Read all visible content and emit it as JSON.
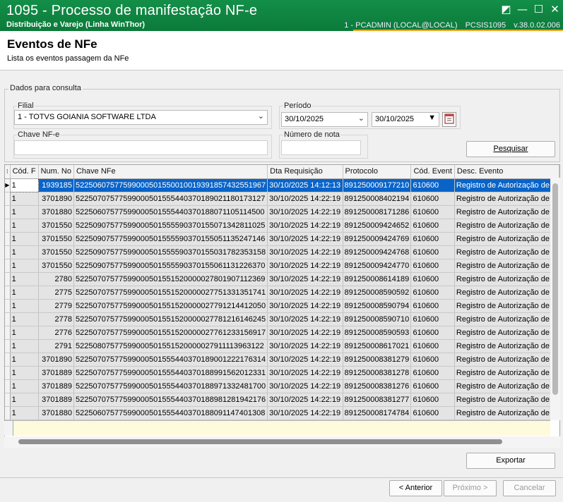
{
  "window": {
    "title": "1095 - Processo de manifestação NF-e",
    "subtitle": "Distribuição e Varejo (Linha WinThor)",
    "user": "1 - PCADMIN (LOCAL@LOCAL)",
    "program": "PCSIS1095",
    "version": "v.38.0.02.006",
    "buttons": [
      "◩",
      "—",
      "☐",
      "✕"
    ]
  },
  "header": {
    "title": "Eventos de NFe",
    "subtitle": "Lista os eventos passagem da NFe"
  },
  "query": {
    "group_title": "Dados para consulta",
    "filial_label": "Filial",
    "filial_value": "1 - TOTVS GOIANIA SOFTWARE LTDA",
    "periodo_label": "Período",
    "date_from": "30/10/2025",
    "date_to": "30/10/2025",
    "chave_label": "Chave NF-e",
    "chave_value": "",
    "numero_label": "Número de nota",
    "numero_value": "",
    "search_button": "Pesquisar"
  },
  "grid": {
    "columns": [
      "Cód. F",
      "Num. No",
      "Chave NFe",
      "Dta Requisição",
      "Protocolo",
      "Cód. Event",
      "Desc. Evento"
    ],
    "rows": [
      [
        "1",
        "1939185",
        "52250607577599000501550010019391857432551967",
        "30/10/2025 14:12:13",
        "891250009177210",
        "610600",
        "Registro de Autorização de C"
      ],
      [
        "1",
        "3701890",
        "52250707577599000501555440370189021180173127",
        "30/10/2025 14:22:19",
        "891250008402194",
        "610600",
        "Registro de Autorização de C"
      ],
      [
        "1",
        "3701880",
        "52250607577599000501555440370188071105114500",
        "30/10/2025 14:22:19",
        "891250008171286",
        "610600",
        "Registro de Autorização de C"
      ],
      [
        "1",
        "3701550",
        "52250907577599000501555590370155071342811025",
        "30/10/2025 14:22:19",
        "891250009424652",
        "610600",
        "Registro de Autorização de C"
      ],
      [
        "1",
        "3701550",
        "52250907577599000501555590370155051135247146",
        "30/10/2025 14:22:19",
        "891250009424769",
        "610600",
        "Registro de Autorização de C"
      ],
      [
        "1",
        "3701550",
        "52250907577599000501555590370155031782353158",
        "30/10/2025 14:22:19",
        "891250009424768",
        "610600",
        "Registro de Autorização de C"
      ],
      [
        "1",
        "3701550",
        "52250907577599000501555590370155061131226370",
        "30/10/2025 14:22:19",
        "891250009424770",
        "610600",
        "Registro de Autorização de C"
      ],
      [
        "1",
        "2780",
        "52250707577599000501551520000027801907112369",
        "30/10/2025 14:22:19",
        "891250008614189",
        "610600",
        "Registro de Autorização de C"
      ],
      [
        "1",
        "2775",
        "52250707577599000501551520000027751331351741",
        "30/10/2025 14:22:19",
        "891250008590592",
        "610600",
        "Registro de Autorização de C"
      ],
      [
        "1",
        "2779",
        "52250707577599000501551520000027791214412050",
        "30/10/2025 14:22:19",
        "891250008590794",
        "610600",
        "Registro de Autorização de C"
      ],
      [
        "1",
        "2778",
        "52250707577599000501551520000027781216146245",
        "30/10/2025 14:22:19",
        "891250008590710",
        "610600",
        "Registro de Autorização de C"
      ],
      [
        "1",
        "2776",
        "52250707577599000501551520000027761233156917",
        "30/10/2025 14:22:19",
        "891250008590593",
        "610600",
        "Registro de Autorização de C"
      ],
      [
        "1",
        "2791",
        "52250807577599000501551520000027911113963122",
        "30/10/2025 14:22:19",
        "891250008617021",
        "610600",
        "Registro de Autorização de C"
      ],
      [
        "1",
        "3701890",
        "52250707577599000501555440370189001222176314",
        "30/10/2025 14:22:19",
        "891250008381279",
        "610600",
        "Registro de Autorização de C"
      ],
      [
        "1",
        "3701889",
        "52250707577599000501555440370188991562012331",
        "30/10/2025 14:22:19",
        "891250008381278",
        "610600",
        "Registro de Autorização de C"
      ],
      [
        "1",
        "3701889",
        "52250707577599000501555440370188971332481700",
        "30/10/2025 14:22:19",
        "891250008381276",
        "610600",
        "Registro de Autorização de C"
      ],
      [
        "1",
        "3701889",
        "52250707577599000501555440370188981281942176",
        "30/10/2025 14:22:19",
        "891250008381277",
        "610600",
        "Registro de Autorização de C"
      ],
      [
        "1",
        "3701880",
        "52250607577599000501555440370188091147401308",
        "30/10/2025 14:22:19",
        "891250008174784",
        "610600",
        "Registro de Autorização de C"
      ]
    ],
    "selected_row": 0,
    "current_marker": "▶",
    "corner_glyph": "⁝"
  },
  "footer": {
    "export_button": "Exportar",
    "back_button": "< Anterior",
    "next_button": "Próximo >",
    "cancel_button": "Cancelar"
  }
}
